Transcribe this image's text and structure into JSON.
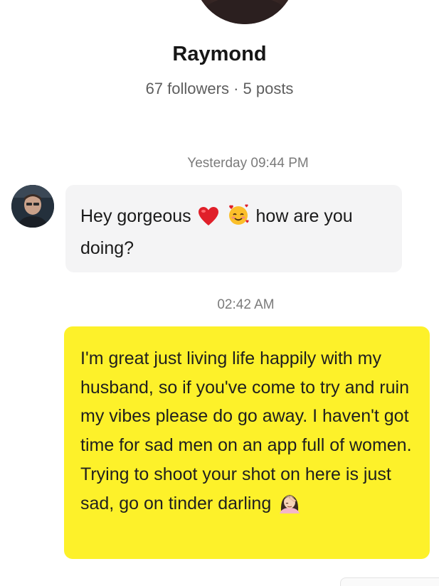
{
  "profile": {
    "name": "Raymond",
    "stats": "67 followers · 5 posts"
  },
  "conversation": {
    "messages": [
      {
        "timestamp": "Yesterday 09:44 PM",
        "direction": "incoming",
        "text_before": "Hey gorgeous",
        "emojis": [
          "red-heart-emoji",
          "smiling-face-with-hearts-emoji"
        ],
        "text_after": "how are you doing?"
      },
      {
        "timestamp": "02:42 AM",
        "direction": "outgoing",
        "text": "I'm great just living life happily with my husband, so if you've come to try and ruin my vibes please do go away. I haven't got time for sad men on an app full of women. Trying to shoot your shot on here is just sad, go on tinder darling",
        "emojis": [
          "woman-facepalming-emoji"
        ]
      }
    ]
  },
  "colors": {
    "incoming_bubble": "#f4f4f5",
    "outgoing_bubble": "#fdf12a",
    "timestamp_text": "#7b7b7b"
  }
}
